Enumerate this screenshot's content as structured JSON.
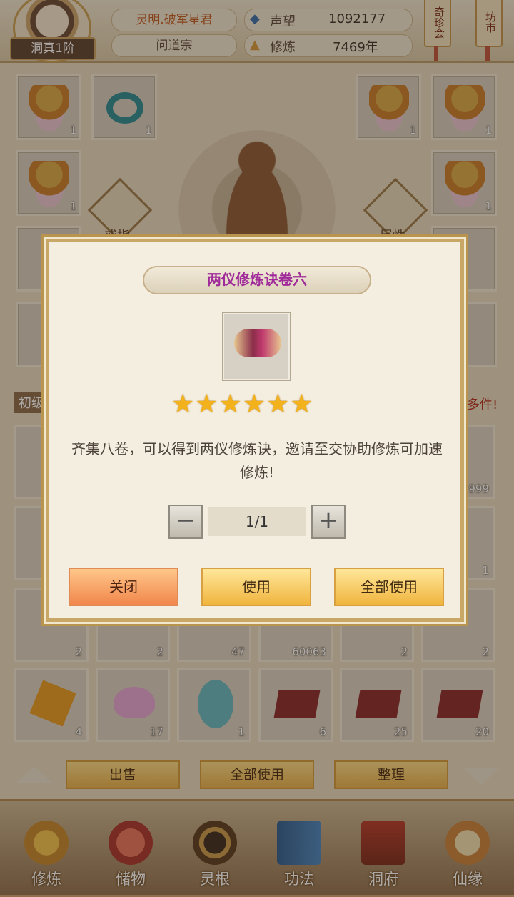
{
  "header": {
    "rank": "洞真1阶",
    "character_name": "灵明.破军星君",
    "sect": "问道宗",
    "reputation_label": "声望",
    "reputation_value": "1092177",
    "cultivation_label": "修炼",
    "cultivation_value": "7469年",
    "right_tags": [
      "奇珍会",
      "坊市"
    ]
  },
  "equipment": {
    "left_slots": [
      {
        "icon": "robe-icon",
        "count": "1"
      },
      {
        "icon": "ring-icon",
        "count": "1"
      },
      {
        "icon": "robe-icon",
        "count": "1"
      }
    ],
    "right_slots": [
      {
        "icon": "robe-icon",
        "count": "1"
      },
      {
        "icon": "robe-icon",
        "count": "1"
      },
      {
        "icon": "robe-icon",
        "count": "1"
      }
    ],
    "ring_label": "戒指",
    "attr_label": "属性",
    "partial_left_label": "初级",
    "partial_right_label": "多件!"
  },
  "inventory": {
    "row_a_counts": [
      "",
      "",
      "",
      "",
      "",
      "999"
    ],
    "row_b_counts": [
      "",
      "",
      "",
      "",
      "",
      "1"
    ],
    "row_c_counts": [
      "2",
      "2",
      "47",
      "60063",
      "2",
      "2"
    ],
    "row_d_counts": [
      "4",
      "17",
      "1",
      "6",
      "25",
      "20"
    ]
  },
  "bottom_buttons": {
    "sell": "出售",
    "use_all": "全部使用",
    "sort": "整理"
  },
  "nav": [
    {
      "label": "修炼",
      "icon": "monk-icon"
    },
    {
      "label": "储物",
      "icon": "bag-icon"
    },
    {
      "label": "灵根",
      "icon": "spirit-root-icon"
    },
    {
      "label": "功法",
      "icon": "book-icon"
    },
    {
      "label": "洞府",
      "icon": "cave-house-icon"
    },
    {
      "label": "仙缘",
      "icon": "fortune-icon"
    }
  ],
  "dialog": {
    "title": "两仪修炼诀卷六",
    "item_icon": "scroll-icon",
    "stars": "★★★★★★",
    "description": "齐集八卷，可以得到两仪修炼诀，邀请至交协助修炼可加速修炼!",
    "quantity": "1/1",
    "minus": "−",
    "plus": "+",
    "close_label": "关闭",
    "use_label": "使用",
    "use_all_label": "全部使用"
  },
  "colors": {
    "title_purple": "#a02a9a",
    "star_gold": "#f3b21b",
    "button_orange": "#f1874c",
    "button_gold": "#f0b53e"
  }
}
